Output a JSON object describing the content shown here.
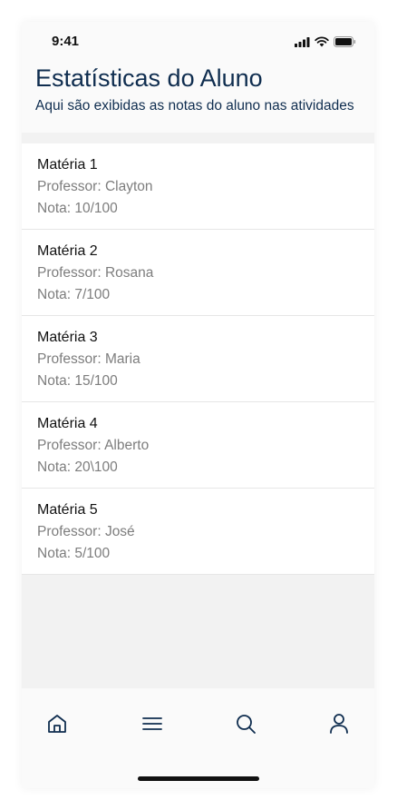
{
  "status_bar": {
    "time": "9:41"
  },
  "header": {
    "title": "Estatísticas do Aluno",
    "subtitle": "Aqui são exibidas as notas do aluno nas atividades"
  },
  "subjects": [
    {
      "name": "Matéria 1",
      "professor": "Professor: Clayton",
      "grade": "Nota: 10/100"
    },
    {
      "name": "Matéria 2",
      "professor": "Professor: Rosana",
      "grade": "Nota: 7/100"
    },
    {
      "name": "Matéria 3",
      "professor": "Professor: Maria",
      "grade": "Nota: 15/100"
    },
    {
      "name": "Matéria 4",
      "professor": "Professor: Alberto",
      "grade": "Nota: 20\\100"
    },
    {
      "name": "Matéria 5",
      "professor": "Professor: José",
      "grade": "Nota: 5/100"
    }
  ],
  "tab_bar": {
    "items": [
      {
        "icon": "home-icon"
      },
      {
        "icon": "menu-icon"
      },
      {
        "icon": "search-icon"
      },
      {
        "icon": "profile-icon"
      }
    ]
  },
  "colors": {
    "header_text": "#0f2d4f",
    "secondary_text": "#7d7d7d",
    "icon": "#0f2d4f"
  }
}
